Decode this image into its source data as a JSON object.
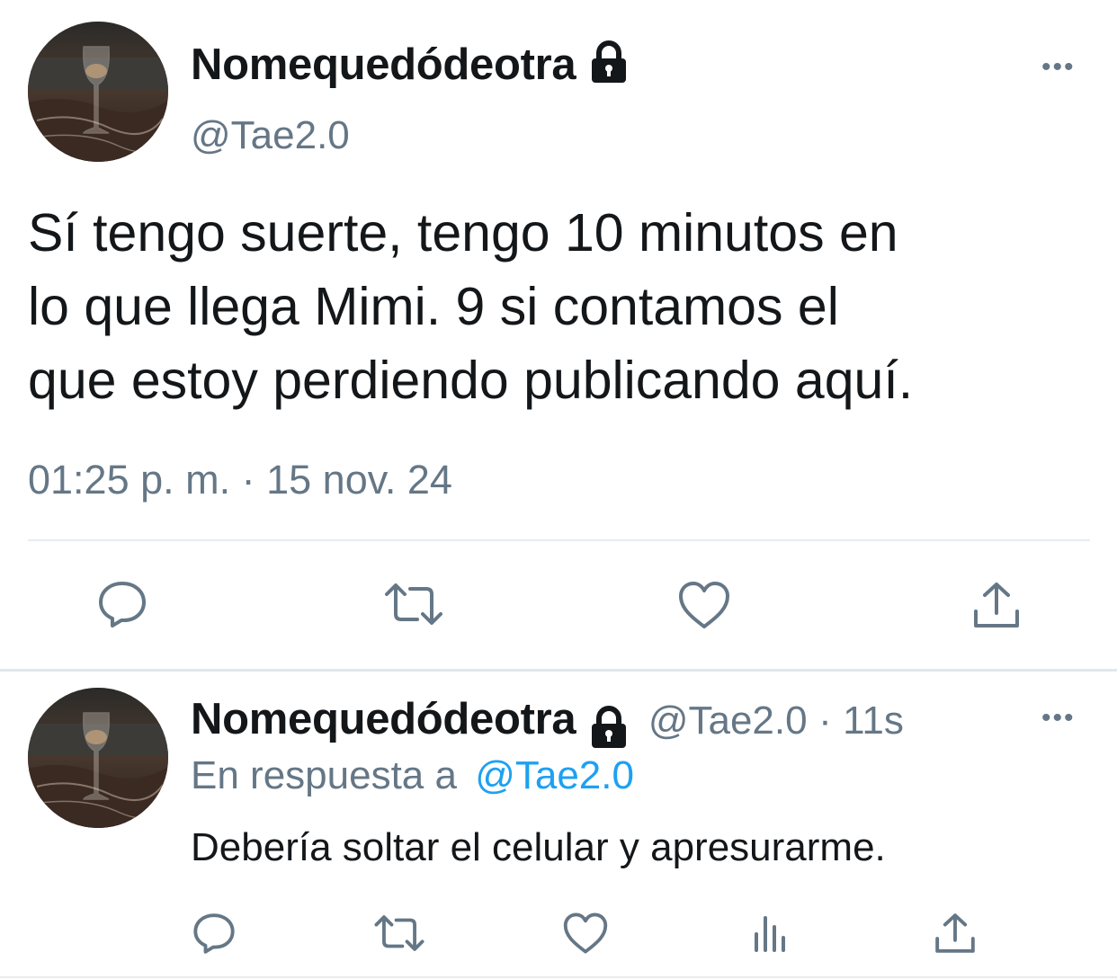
{
  "main_tweet": {
    "display_name": "Nomequedódeotra",
    "handle": "@Tae2.0",
    "text_lines": [
      "Sí tengo suerte, tengo 10 minutos en",
      "lo que llega Mimi. 9 si contamos el",
      "que estoy perdiendo publicando aquí."
    ],
    "timestamp": "01:25 p. m. · 15 nov. 24",
    "more_label": "•••"
  },
  "reply_tweet": {
    "display_name": "Nomequedódeotra",
    "handle": "@Tae2.0",
    "separator": "·",
    "age": "11s",
    "in_reply_to_label": "En respuesta a",
    "in_reply_to_handle": "@Tae2.0",
    "text": "Debería soltar el celular y apresurarme.",
    "more_label": "•••"
  },
  "icons": [
    "reply-icon",
    "retweet-icon",
    "like-icon",
    "share-icon",
    "analytics-icon",
    "lock-icon",
    "more-icon"
  ],
  "colors": {
    "text": "#14171a",
    "secondary": "#657786",
    "link": "#1da1f2",
    "divider": "#e6ecf0"
  }
}
